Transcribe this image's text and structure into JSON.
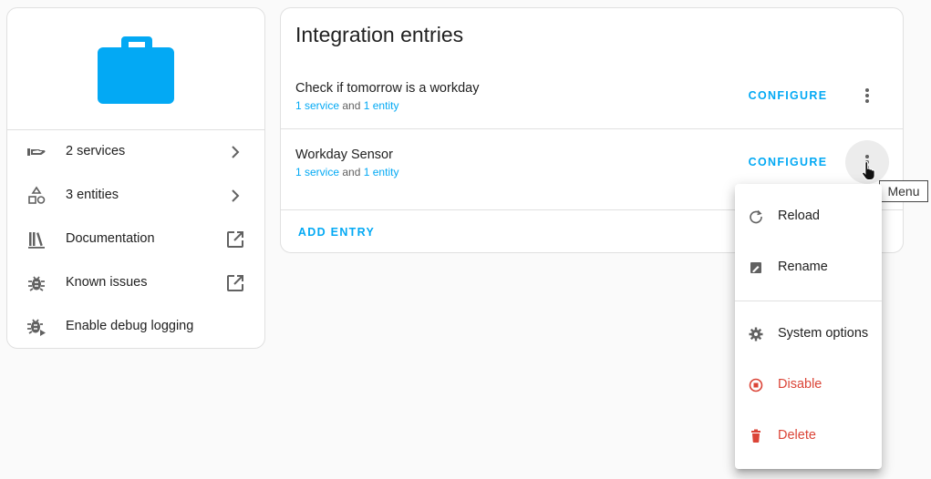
{
  "colors": {
    "accent": "#03a9f4",
    "danger": "#db4437",
    "logo": "#03a9f4"
  },
  "info_card": {
    "logo_icon": "briefcase-icon",
    "items": [
      {
        "label": "2 services",
        "icon": "service-hand-icon",
        "trailing": "chevron-right-icon"
      },
      {
        "label": "3 entities",
        "icon": "shapes-icon",
        "trailing": "chevron-right-icon"
      },
      {
        "label": "Documentation",
        "icon": "bookshelf-icon",
        "trailing": "open-in-new-icon"
      },
      {
        "label": "Known issues",
        "icon": "bug-icon",
        "trailing": "open-in-new-icon"
      },
      {
        "label": "Enable debug logging",
        "icon": "bug-play-icon",
        "trailing": ""
      }
    ]
  },
  "entries_card": {
    "title": "Integration entries",
    "entries": [
      {
        "name": "Check if tomorrow is a workday",
        "service_link": "1 service",
        "and_text": "and",
        "entity_link": "1 entity",
        "configure_label": "CONFIGURE"
      },
      {
        "name": "Workday Sensor",
        "service_link": "1 service",
        "and_text": "and",
        "entity_link": "1 entity",
        "configure_label": "CONFIGURE"
      }
    ],
    "add_entry_label": "ADD ENTRY"
  },
  "tooltip": {
    "text": "Menu"
  },
  "menu": {
    "items": [
      {
        "label": "Reload",
        "icon": "reload-icon"
      },
      {
        "label": "Rename",
        "icon": "rename-icon"
      },
      {
        "label": "System options",
        "icon": "gear-icon"
      },
      {
        "label": "Disable",
        "icon": "stop-circle-icon"
      },
      {
        "label": "Delete",
        "icon": "trash-icon"
      }
    ]
  }
}
